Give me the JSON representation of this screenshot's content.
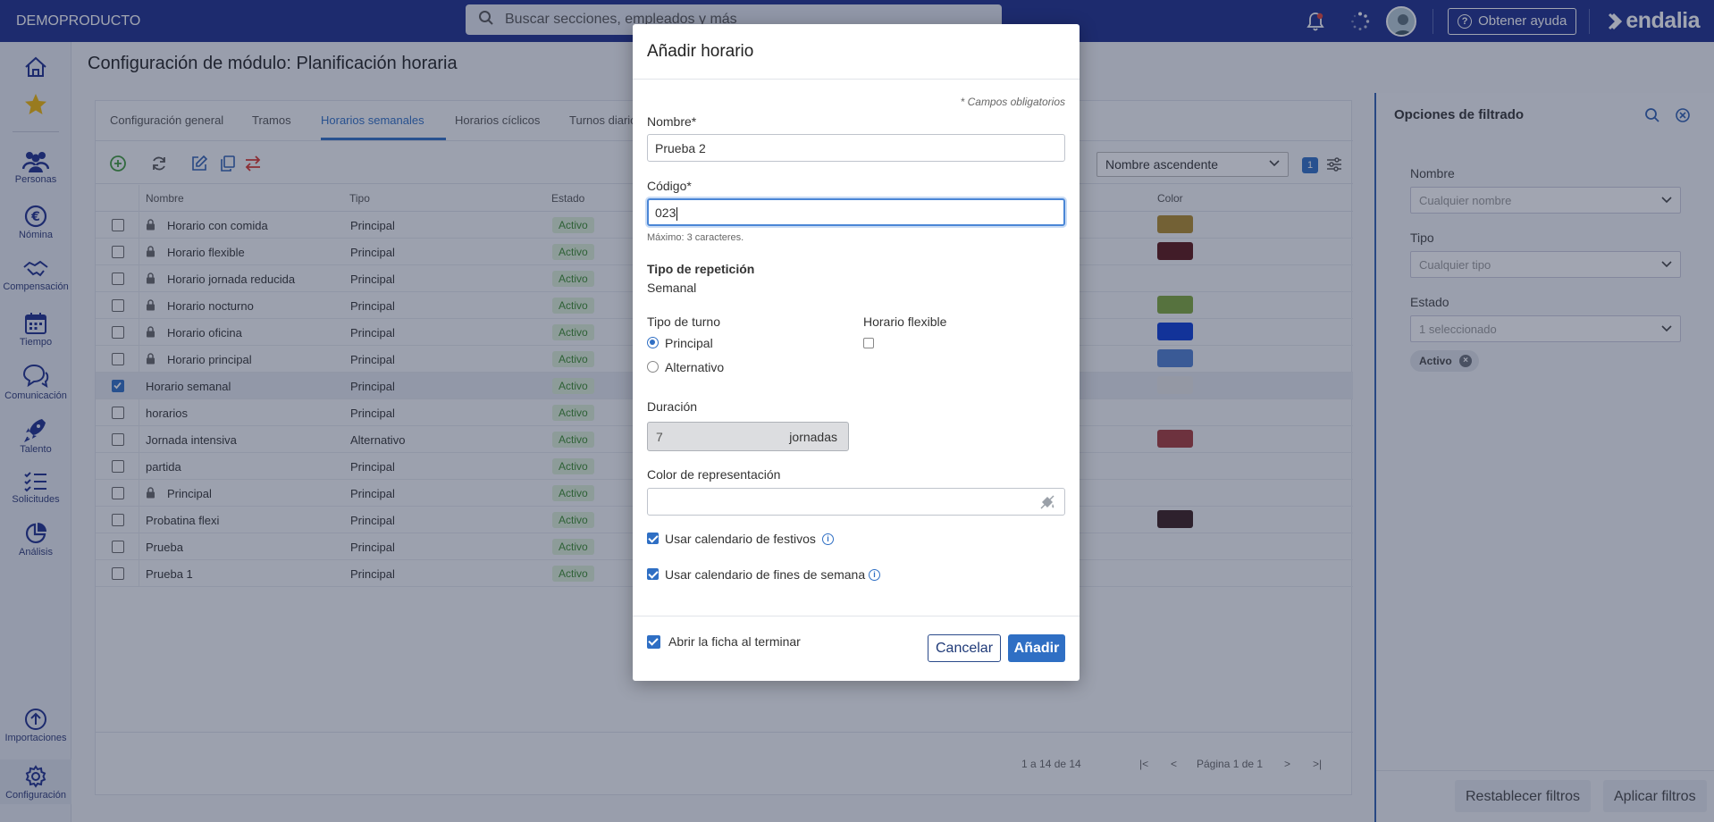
{
  "topbar": {
    "company": "DEMOPRODUCTO",
    "search_placeholder": "Buscar secciones, empleados y más",
    "help_label": "Obtener ayuda",
    "logo": "endalia"
  },
  "sidebar": {
    "items": [
      {
        "label": "",
        "icon": "home-icon"
      },
      {
        "label": "",
        "icon": "star-icon"
      },
      {
        "label": "Personas",
        "icon": "people-icon"
      },
      {
        "label": "Nómina",
        "icon": "euro-icon"
      },
      {
        "label": "Compensación",
        "icon": "handshake-icon"
      },
      {
        "label": "Tiempo",
        "icon": "calendar-icon"
      },
      {
        "label": "Comunicación",
        "icon": "chat-icon"
      },
      {
        "label": "Talento",
        "icon": "rocket-icon"
      },
      {
        "label": "Solicitudes",
        "icon": "checklist-icon"
      },
      {
        "label": "Análisis",
        "icon": "pie-chart-icon"
      },
      {
        "label": "Importaciones",
        "icon": "upload-icon"
      },
      {
        "label": "Configuración",
        "icon": "gear-icon"
      }
    ]
  },
  "page": {
    "title": "Configuración de módulo: Planificación horaria",
    "tabs": [
      "Configuración general",
      "Tramos",
      "Horarios semanales",
      "Horarios cíclicos",
      "Turnos diarios"
    ],
    "active_tab": "Horarios semanales",
    "sort_value": "Nombre ascendente",
    "filter_count": "1",
    "columns": {
      "name": "Nombre",
      "type": "Tipo",
      "status": "Estado",
      "color": "Color"
    },
    "rows": [
      {
        "name": "Horario con comida",
        "type": "Principal",
        "status": "Activo",
        "locked": true,
        "checked": false,
        "color": "#b08a2a"
      },
      {
        "name": "Horario flexible",
        "type": "Principal",
        "status": "Activo",
        "locked": true,
        "checked": false,
        "color": "#5a1414"
      },
      {
        "name": "Horario jornada reducida",
        "type": "Principal",
        "status": "Activo",
        "locked": true,
        "checked": false,
        "color": ""
      },
      {
        "name": "Horario nocturno",
        "type": "Principal",
        "status": "Activo",
        "locked": true,
        "checked": false,
        "color": "#7fa83a"
      },
      {
        "name": "Horario oficina",
        "type": "Principal",
        "status": "Activo",
        "locked": true,
        "checked": false,
        "color": "#0a3bd6"
      },
      {
        "name": "Horario principal",
        "type": "Principal",
        "status": "Activo",
        "locked": true,
        "checked": false,
        "color": "#4f7fd0"
      },
      {
        "name": "Horario semanal",
        "type": "Principal",
        "status": "Activo",
        "locked": false,
        "checked": true,
        "color": "#e9e9e9"
      },
      {
        "name": "horarios",
        "type": "Principal",
        "status": "Activo",
        "locked": false,
        "checked": false,
        "color": ""
      },
      {
        "name": "Jornada intensiva",
        "type": "Alternativo",
        "status": "Activo",
        "locked": false,
        "checked": false,
        "color": "#a53a3a"
      },
      {
        "name": "partida",
        "type": "Principal",
        "status": "Activo",
        "locked": false,
        "checked": false,
        "color": ""
      },
      {
        "name": "Principal",
        "type": "Principal",
        "status": "Activo",
        "locked": true,
        "checked": false,
        "color": ""
      },
      {
        "name": "Probatina flexi",
        "type": "Principal",
        "status": "Activo",
        "locked": false,
        "checked": false,
        "color": "#3a1c1c"
      },
      {
        "name": "Prueba",
        "type": "Principal",
        "status": "Activo",
        "locked": false,
        "checked": false,
        "color": ""
      },
      {
        "name": "Prueba 1",
        "type": "Principal",
        "status": "Activo",
        "locked": false,
        "checked": false,
        "color": ""
      }
    ],
    "pager": {
      "range": "1 a 14 de 14",
      "page": "Página 1 de 1"
    }
  },
  "filters": {
    "title": "Opciones de filtrado",
    "name_label": "Nombre",
    "name_placeholder": "Cualquier nombre",
    "type_label": "Tipo",
    "type_placeholder": "Cualquier tipo",
    "status_label": "Estado",
    "status_value": "1 seleccionado",
    "chip": "Activo",
    "reset": "Restablecer filtros",
    "apply": "Aplicar filtros"
  },
  "modal": {
    "title": "Añadir horario",
    "required_note": "* Campos obligatorios",
    "name_label": "Nombre*",
    "name_value": "Prueba 2",
    "code_label": "Código*",
    "code_value": "023",
    "code_hint": "Máximo: 3 caracteres.",
    "repeat_label": "Tipo de repetición",
    "repeat_value": "Semanal",
    "shift_label": "Tipo de turno",
    "shift_principal": "Principal",
    "shift_alternativo": "Alternativo",
    "flex_label": "Horario flexible",
    "duration_label": "Duración",
    "duration_value": "7",
    "duration_unit": "jornadas",
    "color_label": "Color de representación",
    "holidays_label": "Usar calendario de festivos",
    "weekends_label": "Usar calendario de fines de semana",
    "open_after_label": "Abrir la ficha al terminar",
    "cancel": "Cancelar",
    "add": "Añadir"
  }
}
